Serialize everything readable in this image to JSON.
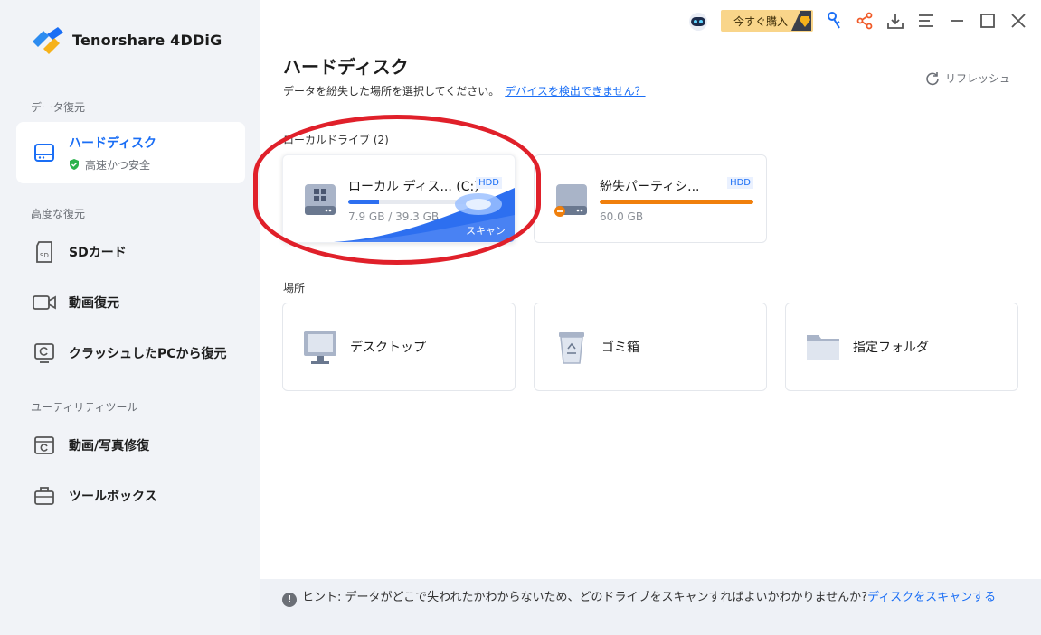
{
  "app": {
    "name": "Tenorshare 4DDiG"
  },
  "sidebar": {
    "sections": [
      {
        "title": "データ復元"
      },
      {
        "title": "高度な復元"
      },
      {
        "title": "ユーティリティツール"
      }
    ],
    "items": [
      {
        "label": "ハードディスク",
        "sub": "高速かつ安全",
        "icon": "hard-disk-icon",
        "active": true
      },
      {
        "label": "SDカード",
        "icon": "sd-card-icon"
      },
      {
        "label": "動画復元",
        "icon": "video-icon"
      },
      {
        "label": "クラッシュしたPCから復元",
        "icon": "crashed-pc-icon"
      },
      {
        "label": "動画/写真修復",
        "icon": "photo-repair-icon"
      },
      {
        "label": "ツールボックス",
        "icon": "toolbox-icon"
      }
    ]
  },
  "topbar": {
    "buy_label": "今すぐ購入",
    "icons": [
      "robot-icon",
      "diamond-icon",
      "key-icon",
      "share-icon",
      "download-icon",
      "menu-icon",
      "minimize-icon",
      "maximize-icon",
      "close-icon"
    ]
  },
  "main": {
    "title": "ハードディスク",
    "desc": "データを紛失した場所を選択してください。",
    "detect_link": "デバイスを検出できません？",
    "refresh_label": "リフレッシュ",
    "local_drives_label": "ローカルドライブ (2)",
    "drives": [
      {
        "name": "ローカル ディス... (C:)",
        "badge": "HDD",
        "size": "7.9 GB / 39.3 GB",
        "used_fraction": 0.2,
        "bar_color": "#2d6ff0",
        "scan_label": "スキャン",
        "selected": true
      },
      {
        "name": "紛失パーティシ...",
        "badge": "HDD",
        "size": "60.0 GB",
        "used_fraction": 1.0,
        "bar_color": "#f07f0c",
        "selected": false
      }
    ],
    "locations_label": "場所",
    "locations": [
      {
        "label": "デスクトップ",
        "icon": "desktop-icon"
      },
      {
        "label": "ゴミ箱",
        "icon": "recycle-bin-icon"
      },
      {
        "label": "指定フォルダ",
        "icon": "folder-icon"
      }
    ],
    "hint": {
      "prefix": "ヒント:",
      "text": "データがどこで失われたかわからないため、どのドライブをスキャンすればよいかわかりませんか?",
      "link": "ディスクをスキャンする"
    }
  },
  "colors": {
    "accent": "#1a6ef5",
    "highlight": "#e0202a",
    "buy": "#f9d58a"
  }
}
